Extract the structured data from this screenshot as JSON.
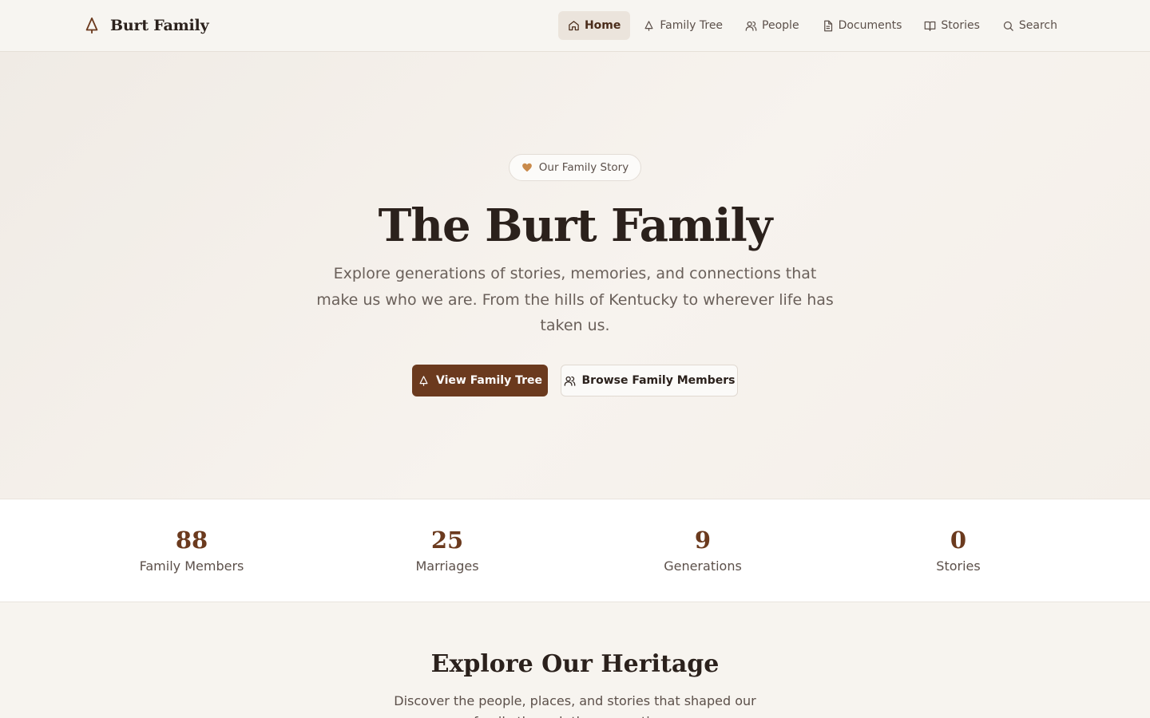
{
  "header": {
    "brand_name": "Burt Family",
    "brand_icon": "tree-icon",
    "nav": [
      {
        "label": "Home",
        "icon": "home-icon",
        "active": true
      },
      {
        "label": "Family Tree",
        "icon": "tree-icon",
        "active": false
      },
      {
        "label": "People",
        "icon": "people-icon",
        "active": false
      },
      {
        "label": "Documents",
        "icon": "document-icon",
        "active": false
      },
      {
        "label": "Stories",
        "icon": "book-icon",
        "active": false
      },
      {
        "label": "Search",
        "icon": "search-icon",
        "active": false
      }
    ]
  },
  "hero": {
    "badge": "Our Family Story",
    "badge_icon": "heart-icon",
    "title": "The Burt Family",
    "subtitle": "Explore generations of stories, memories, and connections that make us who we are. From the hills of Kentucky to wherever life has taken us.",
    "primary_button": "View Family Tree",
    "secondary_button": "Browse Family Members"
  },
  "stats": [
    {
      "value": "88",
      "label": "Family Members"
    },
    {
      "value": "25",
      "label": "Marriages"
    },
    {
      "value": "9",
      "label": "Generations"
    },
    {
      "value": "0",
      "label": "Stories"
    }
  ],
  "explore": {
    "title": "Explore Our Heritage",
    "subtitle": "Discover the people, places, and stories that shaped our family through the generations."
  },
  "colors": {
    "accent": "#6b3a1e",
    "background": "#f7f4ef",
    "heart": "#c98a4b"
  }
}
